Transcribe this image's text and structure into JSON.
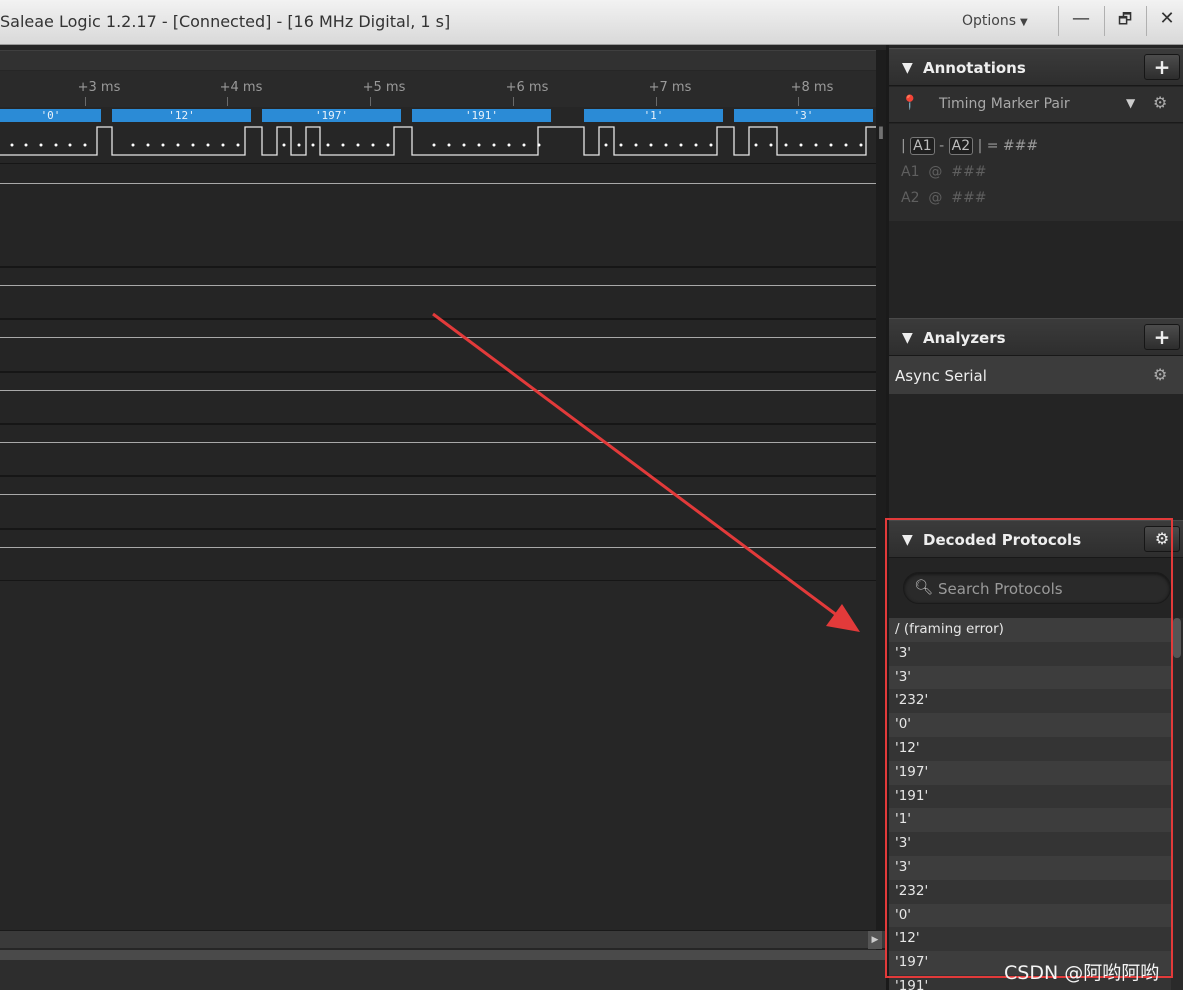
{
  "window": {
    "title": "Saleae Logic 1.2.17 - [Connected] - [16 MHz Digital, 1 s]",
    "options_label": "Options",
    "minimize_label": "—",
    "restore_label": "🗗",
    "close_label": "✕"
  },
  "timeline": {
    "ticks": [
      "+3 ms",
      "+4 ms",
      "+5 ms",
      "+6 ms",
      "+7 ms",
      "+8 ms"
    ],
    "decoded_bytes": [
      "'0'",
      "'12'",
      "'197'",
      "'191'",
      "'1'",
      "'3'"
    ]
  },
  "annotations": {
    "header": "Annotations",
    "add_label": "+",
    "marker_label": "Timing Marker Pair",
    "line1": {
      "sep1": "|",
      "a1": "A1",
      "dash": "-",
      "a2": "A2",
      "sep2": "|",
      "eq": "=",
      "value": "###"
    },
    "line2": {
      "label": "A1",
      "at": "@",
      "value": "###"
    },
    "line3": {
      "label": "A2",
      "at": "@",
      "value": "###"
    }
  },
  "analyzers": {
    "header": "Analyzers",
    "add_label": "+",
    "items": [
      "Async Serial"
    ]
  },
  "decoded_protocols": {
    "header": "Decoded Protocols",
    "search_placeholder": "Search Protocols",
    "rows": [
      "/ (framing error)",
      "'3'",
      "'3'",
      "'232'",
      "'0'",
      "'12'",
      "'197'",
      "'191'",
      "'1'",
      "'3'",
      "'3'",
      "'232'",
      "'0'",
      "'12'",
      "'197'",
      "'191'"
    ]
  },
  "icons": {
    "collapse": "triangle-down-icon",
    "gear": "gear-icon",
    "search": "magnifier-icon",
    "pin": "marker-pin-icon",
    "dropdown": "chevron-down-icon"
  },
  "colors": {
    "decode_bar": "#2b8bd6",
    "highlight_box": "#e23a3a",
    "background": "#262626"
  },
  "watermark": "CSDN @阿哟阿哟"
}
